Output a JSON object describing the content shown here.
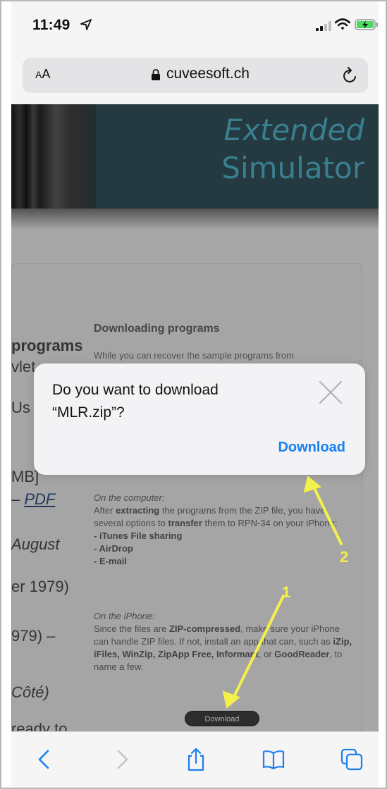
{
  "status_bar": {
    "time": "11:49"
  },
  "address_bar": {
    "reader_label_small": "A",
    "reader_label_big": "A",
    "url": "cuveesoft.ch"
  },
  "banner": {
    "title_line1": "Extended",
    "title_line2": "Simulator"
  },
  "left_column": {
    "programs": "programs",
    "line_a": "vlet",
    "line_b": "Us",
    "line_c": "MB]",
    "pdf_prefix": "– ",
    "pdf": "PDF",
    "august": "August",
    "er1979": "er 1979)",
    "l979": "979) –",
    "cote": "Côté)",
    "ready": "ready to"
  },
  "right_column": {
    "heading": "Downloading programs",
    "intro": "While you can recover the sample programs from",
    "on_computer": "On the computer:",
    "after_1": "After ",
    "after_bold": "extracting",
    "after_2": " the programs from the ZIP file, you have several options to ",
    "transfer_bold": "transfer",
    "after_3": " them to RPN-34 on your iPhone:",
    "opt1": "- iTunes File sharing",
    "opt2": "- AirDrop",
    "opt3": "- E-mail",
    "on_iphone": "On the iPhone:",
    "since_1": "Since the files are ",
    "since_bold": "ZIP-compressed",
    "since_2": ", make sure your iPhone can handle ZIP files. If not, install an app that can, such as ",
    "apps_bold": "iZip, iFiles, WinZip, ZipApp Free, Informant",
    "since_3": ", or ",
    "goodreader_bold": "GoodReader",
    "since_4": ", to name a few.",
    "download_button": "Download"
  },
  "dialog": {
    "line1": "Do you want to download",
    "line2": "“MLR.zip”?",
    "download": "Download"
  },
  "annotations": {
    "label1": "1",
    "label2": "2",
    "color": "#f4f04a"
  },
  "colors": {
    "accent": "#1a7ff0",
    "banner": "#2f4a52",
    "banner_text": "#4ba3b8"
  },
  "toolbar": {
    "icons": [
      "back-icon",
      "forward-icon",
      "share-icon",
      "bookmarks-icon",
      "tabs-icon"
    ]
  }
}
